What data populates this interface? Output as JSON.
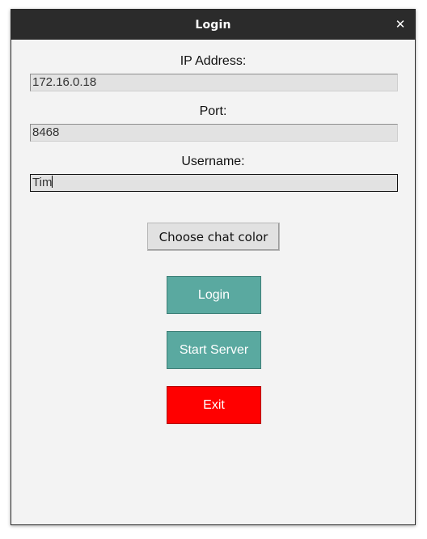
{
  "window": {
    "title": "Login",
    "close_glyph": "✕"
  },
  "form": {
    "ip_label": "IP Address:",
    "ip_value": "172.16.0.18",
    "port_label": "Port:",
    "port_value": "8468",
    "username_label": "Username:",
    "username_value": "Tim"
  },
  "buttons": {
    "choose_color": "Choose chat color",
    "login": "Login",
    "start_server": "Start Server",
    "exit": "Exit"
  },
  "colors": {
    "titlebar": "#2b2b2b",
    "window_bg": "#f3f3f3",
    "teal_button": "#5aa9a0",
    "exit_button": "#ff0000"
  },
  "icons": {
    "close": "close-icon"
  }
}
